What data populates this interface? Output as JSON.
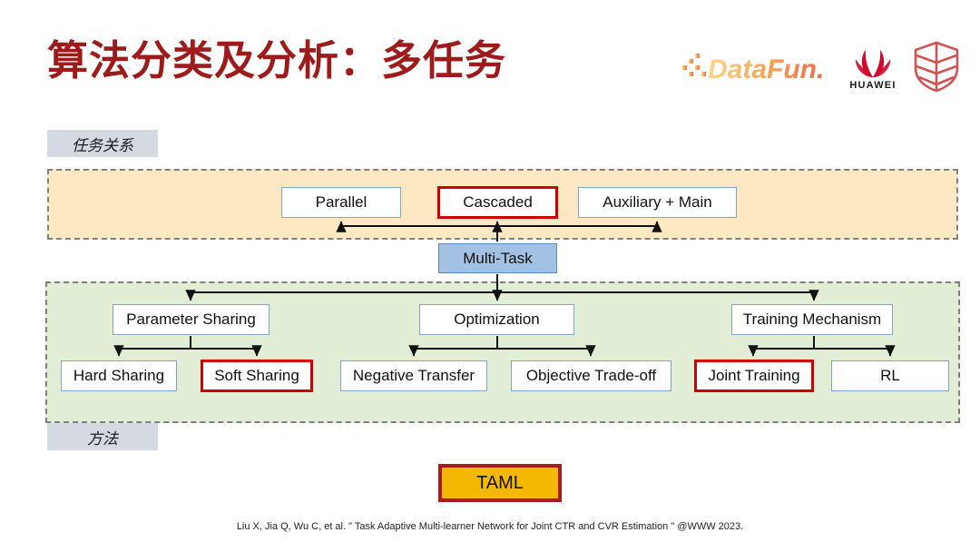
{
  "slide": {
    "title": "算法分类及分析：多任务",
    "title_color": "#9E1B1B",
    "caption": "Liu X, Jia Q, Wu C, et al. \" Task Adaptive Multi-learner Network for Joint CTR and CVR Estimation \" @WWW 2023."
  },
  "logos": [
    {
      "name": "datafun-logo",
      "text": "DataFun."
    },
    {
      "name": "huawei-logo",
      "text": "HUAWEI"
    },
    {
      "name": "shield-logo",
      "text": ""
    }
  ],
  "sections": {
    "relation_tag": "任务关系",
    "method_tag": "方法"
  },
  "diagram": {
    "root": {
      "label": "Multi-Task",
      "fill": "#A3C2E3",
      "highlight": false
    },
    "relation_nodes": [
      {
        "label": "Parallel",
        "highlight": false
      },
      {
        "label": "Cascaded",
        "highlight": true
      },
      {
        "label": "Auxiliary + Main",
        "highlight": false
      }
    ],
    "method_groups": [
      {
        "label": "Parameter Sharing",
        "children": [
          {
            "label": "Hard Sharing",
            "highlight": false
          },
          {
            "label": "Soft Sharing",
            "highlight": true
          }
        ]
      },
      {
        "label": "Optimization",
        "children": [
          {
            "label": "Negative Transfer",
            "highlight": false
          },
          {
            "label": "Objective Trade-off",
            "highlight": false
          }
        ]
      },
      {
        "label": "Training Mechanism",
        "children": [
          {
            "label": "Joint Training",
            "highlight": true
          },
          {
            "label": "RL",
            "highlight": false
          }
        ]
      }
    ],
    "result": {
      "label": "TAML",
      "fill": "#F5B800",
      "border": "#AA1C1C"
    }
  },
  "colors": {
    "highlight_red": "#CE0000",
    "node_border": "#7EA6C9",
    "relation_band": "#FCE8C3",
    "method_band": "#E2EDD6",
    "tag_bg": "#D4D9E2"
  }
}
